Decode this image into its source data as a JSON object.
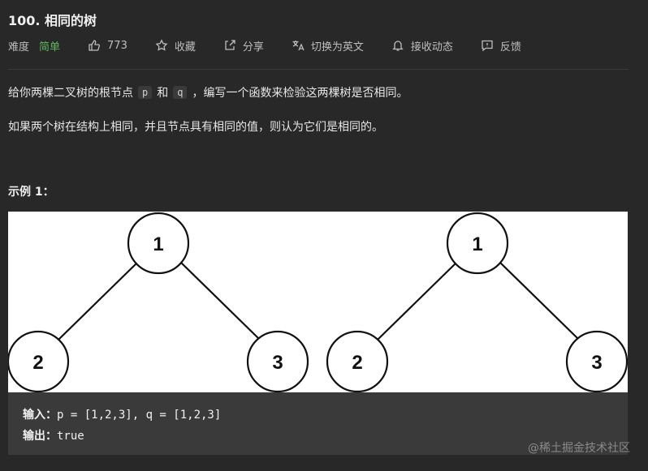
{
  "problem": {
    "title": "100. 相同的树",
    "difficulty_label": "难度",
    "difficulty_value": "简单",
    "likes": "773",
    "favorite": "收藏",
    "share": "分享",
    "switch_lang": "切换为英文",
    "notify": "接收动态",
    "feedback": "反馈"
  },
  "description": {
    "line1_part1": "给你两棵二叉树的根节点",
    "p_var": "p",
    "and": "和",
    "q_var": "q",
    "line1_part2": "，编写一个函数来检验这两棵树是否相同。",
    "line2": "如果两个树在结构上相同，并且节点具有相同的值，则认为它们是相同的。"
  },
  "example": {
    "title": "示例 1：",
    "tree_left": [
      "1",
      "2",
      "3"
    ],
    "tree_right": [
      "1",
      "2",
      "3"
    ],
    "input_label": "输入：",
    "input_value": "p = [1,2,3], q = [1,2,3]",
    "output_label": "输出：",
    "output_value": "true"
  },
  "watermark": "@稀土掘金技术社区"
}
